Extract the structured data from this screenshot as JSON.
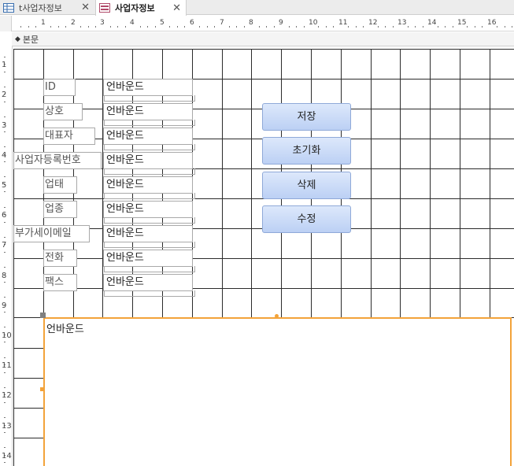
{
  "tabs": [
    {
      "label": "t사업자정보",
      "active": false
    },
    {
      "label": "사업자정보",
      "active": true
    }
  ],
  "ruler": {
    "h_marks": [
      "1",
      "2",
      "3",
      "4",
      "5",
      "6",
      "7",
      "8",
      "9",
      "10",
      "11",
      "12",
      "13",
      "14",
      "15",
      "16"
    ],
    "v_marks": [
      "1",
      "2",
      "3",
      "4",
      "5",
      "6",
      "7",
      "8",
      "9",
      "10",
      "11",
      "12",
      "13",
      "14"
    ]
  },
  "section": {
    "label": "본문"
  },
  "form": {
    "fields": [
      {
        "label": "ID",
        "value": "언바운드"
      },
      {
        "label": "상호",
        "value": "언바운드"
      },
      {
        "label": "대표자",
        "value": "언바운드"
      },
      {
        "label": "사업자등록번호",
        "value": "언바운드"
      },
      {
        "label": "업태",
        "value": "언바운드"
      },
      {
        "label": "업종",
        "value": "언바운드"
      },
      {
        "label": "부가세이메일",
        "value": "언바운드"
      },
      {
        "label": "전화",
        "value": "언바운드"
      },
      {
        "label": "팩스",
        "value": "언바운드"
      }
    ],
    "buttons": [
      {
        "label": "저장"
      },
      {
        "label": "초기화"
      },
      {
        "label": "삭제"
      },
      {
        "label": "수정"
      }
    ],
    "memo_value": "언바운드"
  },
  "colors": {
    "selection": "#f3a33a",
    "button_top": "#dde8fb",
    "button_bottom": "#bcd0f4",
    "grid": "#2b2b2b"
  }
}
